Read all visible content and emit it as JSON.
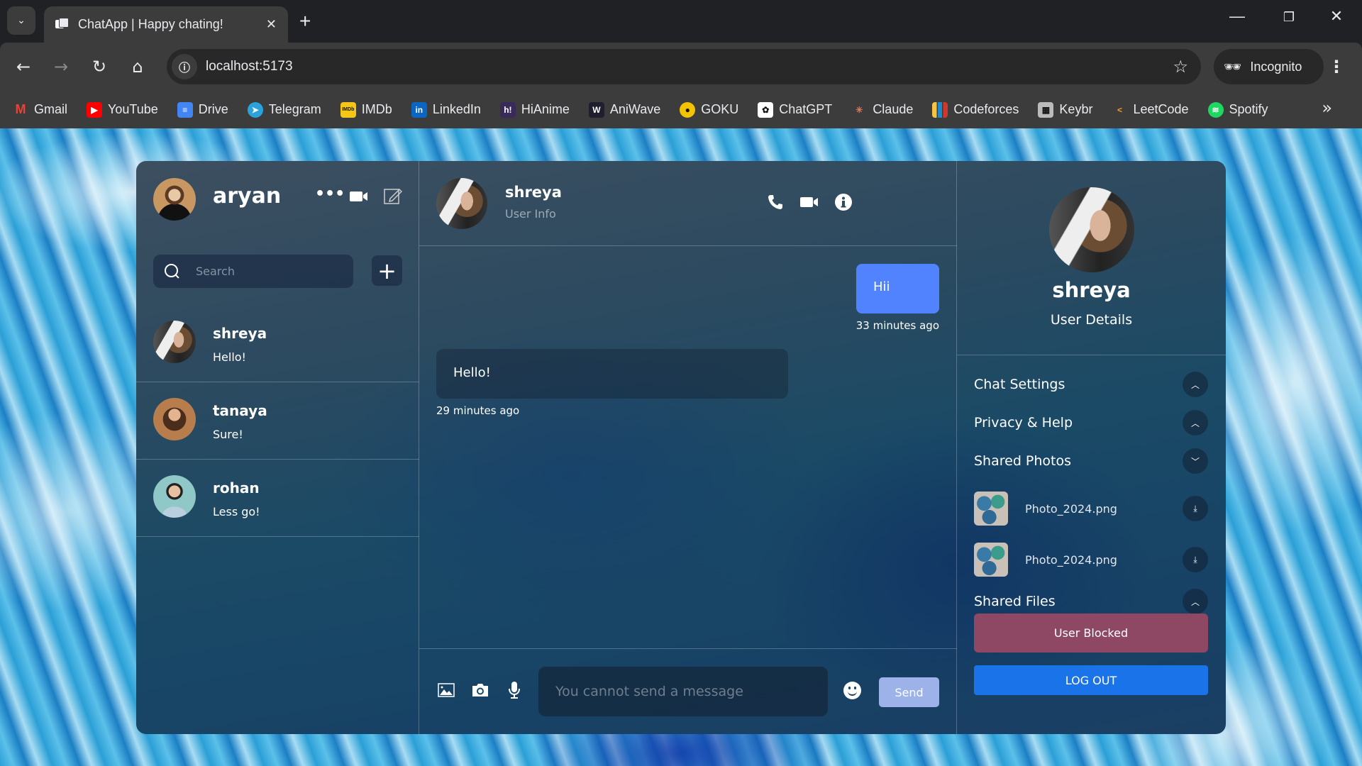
{
  "browser": {
    "tab_title": "ChatApp | Happy chating!",
    "url": "localhost:5173",
    "profile_label": "Incognito",
    "bookmarks": [
      {
        "label": "Gmail",
        "icon": "gmail-icon",
        "color": "#ea4335",
        "glyph": "M"
      },
      {
        "label": "YouTube",
        "icon": "youtube-icon",
        "color": "#ff0000",
        "glyph": "▶"
      },
      {
        "label": "Drive",
        "icon": "drive-docs-icon",
        "color": "#4285f4",
        "glyph": "≡"
      },
      {
        "label": "Telegram",
        "icon": "telegram-icon",
        "color": "#2aa3dd",
        "glyph": "➤"
      },
      {
        "label": "IMDb",
        "icon": "imdb-icon",
        "color": "#f5c518",
        "glyph": "IMDb"
      },
      {
        "label": "LinkedIn",
        "icon": "linkedin-icon",
        "color": "#0a66c2",
        "glyph": "in"
      },
      {
        "label": "HiAnime",
        "icon": "hianime-icon",
        "color": "#3a2a5a",
        "glyph": "h!"
      },
      {
        "label": "AniWave",
        "icon": "aniwave-icon",
        "color": "#1e1e2e",
        "glyph": "W"
      },
      {
        "label": "GOKU",
        "icon": "goku-icon",
        "color": "#f2c300",
        "glyph": "●"
      },
      {
        "label": "ChatGPT",
        "icon": "chatgpt-icon",
        "color": "#ffffff",
        "glyph": "✿"
      },
      {
        "label": "Claude",
        "icon": "claude-icon",
        "color": "#3c3c3c",
        "glyph": "✳"
      },
      {
        "label": "Codeforces",
        "icon": "codeforces-icon",
        "color": "#3c3c3c",
        "glyph": "▮"
      },
      {
        "label": "Keybr",
        "icon": "keybr-icon",
        "color": "#bbbbbb",
        "glyph": "▦"
      },
      {
        "label": "LeetCode",
        "icon": "leetcode-icon",
        "color": "#3c3c3c",
        "glyph": "<"
      },
      {
        "label": "Spotify",
        "icon": "spotify-icon",
        "color": "#1ed760",
        "glyph": "≋"
      }
    ]
  },
  "sidebar": {
    "current_user": "aryan",
    "search_placeholder": "Search",
    "add_label": "+",
    "chats": [
      {
        "name": "shreya",
        "last_message": "Hello!",
        "avatar": "shreya"
      },
      {
        "name": "tanaya",
        "last_message": "Sure!",
        "avatar": "tanaya"
      },
      {
        "name": "rohan",
        "last_message": "Less go!",
        "avatar": "rohan"
      }
    ]
  },
  "chat": {
    "contact_name": "shreya",
    "contact_subtitle": "User Info",
    "messages": [
      {
        "sender": "own",
        "text": "Hii",
        "time": "33 minutes ago"
      },
      {
        "sender": "other",
        "text": "Hello!",
        "time": "29 minutes ago"
      }
    ],
    "input_placeholder": "You cannot send a message",
    "send_label": "Send"
  },
  "details": {
    "name": "shreya",
    "subtitle": "User Details",
    "sections": [
      {
        "label": "Chat Settings",
        "state": "collapsed"
      },
      {
        "label": "Privacy & Help",
        "state": "collapsed"
      },
      {
        "label": "Shared Photos",
        "state": "expanded"
      },
      {
        "label": "Shared Files",
        "state": "collapsed"
      }
    ],
    "photos": [
      {
        "name": "Photo_2024.png"
      },
      {
        "name": "Photo_2024.png"
      }
    ],
    "blocked_label": "User Blocked",
    "logout_label": "LOG OUT"
  },
  "colors": {
    "own_bubble": "#5183fe",
    "send_button": "#9db2e8",
    "blocked_button": "#8e4863",
    "logout_button": "#1a73e8"
  }
}
